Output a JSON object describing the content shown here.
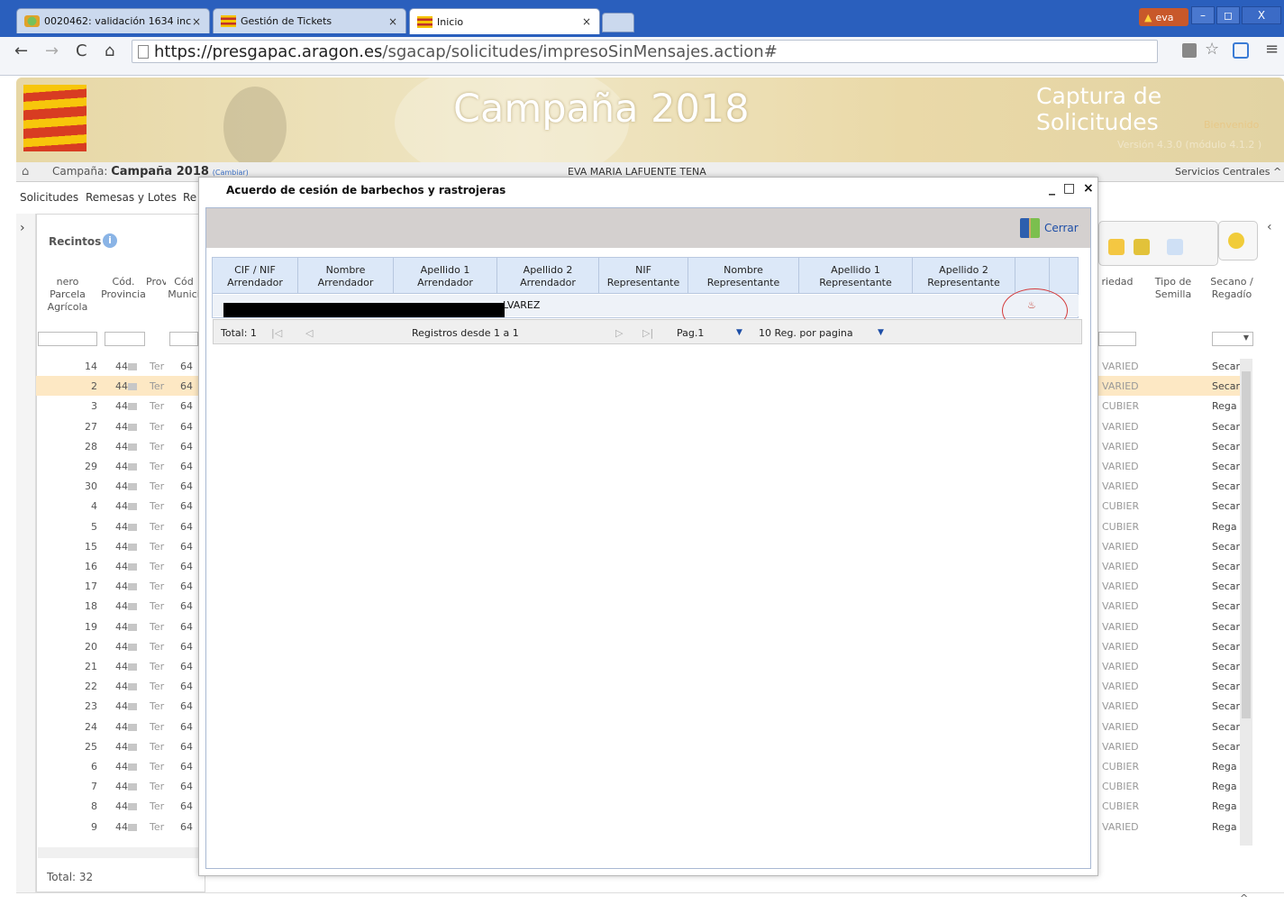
{
  "browser": {
    "tabs": [
      {
        "title": "0020462: validación 1634 inc"
      },
      {
        "title": "Gestión de Tickets"
      },
      {
        "title": "Inicio"
      }
    ],
    "user_badge": "eva",
    "window_controls": [
      "–",
      "◻",
      "X"
    ],
    "url_host": "https://presgapac.aragon.es",
    "url_path": "/sgacap/solicitudes/impresoSinMensajes.action#"
  },
  "app": {
    "campaign_title": "Campaña 2018",
    "capture_title": "Captura de Solicitudes",
    "welcome": "Bienvenido",
    "version": "Versión 4.3.0 (módulo 4.1.2 )",
    "campaign_label": "Campaña:",
    "campaign_value": "Campaña 2018",
    "campaign_change": "(Cambiar)",
    "user_name": "EVA MARIA LAFUENTE TENA",
    "services": "Servicios Centrales ^",
    "menu": [
      "Solicitudes",
      "Remesas y Lotes",
      "Re"
    ]
  },
  "recintos": {
    "title": "Recintos",
    "headers": [
      "nero Parcela Agrícola",
      "Cód. Provincia",
      "Prov",
      "Cód Munici"
    ],
    "rows": [
      {
        "n": "14",
        "prov": "44",
        "name": "Ter",
        "mun": "64"
      },
      {
        "n": "2",
        "prov": "44",
        "name": "Ter",
        "mun": "64"
      },
      {
        "n": "3",
        "prov": "44",
        "name": "Ter",
        "mun": "64"
      },
      {
        "n": "27",
        "prov": "44",
        "name": "Ter",
        "mun": "64"
      },
      {
        "n": "28",
        "prov": "44",
        "name": "Ter",
        "mun": "64"
      },
      {
        "n": "29",
        "prov": "44",
        "name": "Ter",
        "mun": "64"
      },
      {
        "n": "30",
        "prov": "44",
        "name": "Ter",
        "mun": "64"
      },
      {
        "n": "4",
        "prov": "44",
        "name": "Ter",
        "mun": "64"
      },
      {
        "n": "5",
        "prov": "44",
        "name": "Ter",
        "mun": "64"
      },
      {
        "n": "15",
        "prov": "44",
        "name": "Ter",
        "mun": "64"
      },
      {
        "n": "16",
        "prov": "44",
        "name": "Ter",
        "mun": "64"
      },
      {
        "n": "17",
        "prov": "44",
        "name": "Ter",
        "mun": "64"
      },
      {
        "n": "18",
        "prov": "44",
        "name": "Ter",
        "mun": "64"
      },
      {
        "n": "19",
        "prov": "44",
        "name": "Ter",
        "mun": "64"
      },
      {
        "n": "20",
        "prov": "44",
        "name": "Ter",
        "mun": "64"
      },
      {
        "n": "21",
        "prov": "44",
        "name": "Ter",
        "mun": "64"
      },
      {
        "n": "22",
        "prov": "44",
        "name": "Ter",
        "mun": "64"
      },
      {
        "n": "23",
        "prov": "44",
        "name": "Ter",
        "mun": "64"
      },
      {
        "n": "24",
        "prov": "44",
        "name": "Ter",
        "mun": "64"
      },
      {
        "n": "25",
        "prov": "44",
        "name": "Ter",
        "mun": "64"
      },
      {
        "n": "6",
        "prov": "44",
        "name": "Ter",
        "mun": "64"
      },
      {
        "n": "7",
        "prov": "44",
        "name": "Ter",
        "mun": "64"
      },
      {
        "n": "8",
        "prov": "44",
        "name": "Ter",
        "mun": "64"
      },
      {
        "n": "9",
        "prov": "44",
        "name": "Ter",
        "mun": "64"
      }
    ],
    "total": "Total: 32"
  },
  "right_grid": {
    "headers": [
      "riedad",
      "Tipo de Semilla",
      "Secano / Regadío"
    ],
    "rows": [
      {
        "a": "VARIED",
        "b": "Secar"
      },
      {
        "a": "VARIED",
        "b": "Secar"
      },
      {
        "a": "CUBIER",
        "b": "Rega"
      },
      {
        "a": "VARIED",
        "b": "Secar"
      },
      {
        "a": "VARIED",
        "b": "Secar"
      },
      {
        "a": "VARIED",
        "b": "Secar"
      },
      {
        "a": "VARIED",
        "b": "Secar"
      },
      {
        "a": "CUBIER",
        "b": "Secar"
      },
      {
        "a": "CUBIER",
        "b": "Rega"
      },
      {
        "a": "VARIED",
        "b": "Secar"
      },
      {
        "a": "VARIED",
        "b": "Secar"
      },
      {
        "a": "VARIED",
        "b": "Secar"
      },
      {
        "a": "VARIED",
        "b": "Secar"
      },
      {
        "a": "VARIED",
        "b": "Secar"
      },
      {
        "a": "VARIED",
        "b": "Secar"
      },
      {
        "a": "VARIED",
        "b": "Secar"
      },
      {
        "a": "VARIED",
        "b": "Secar"
      },
      {
        "a": "VARIED",
        "b": "Secar"
      },
      {
        "a": "VARIED",
        "b": "Secar"
      },
      {
        "a": "VARIED",
        "b": "Secar"
      },
      {
        "a": "CUBIER",
        "b": "Rega"
      },
      {
        "a": "CUBIER",
        "b": "Rega"
      },
      {
        "a": "CUBIER",
        "b": "Rega"
      },
      {
        "a": "VARIED",
        "b": "Rega"
      }
    ]
  },
  "modal": {
    "title": "Acuerdo de cesión de barbechos y rastrojeras",
    "controls": "_ □ ×",
    "close_label": "Cerrar",
    "headers": [
      "CIF / NIF Arrendador",
      "Nombre Arrendador",
      "Apellido 1 Arrendador",
      "Apellido 2 Arrendador",
      "NIF Representante",
      "Nombre Representante",
      "Apellido 1 Representante",
      "Apellido 2 Representante"
    ],
    "row_visible_text": "LVAREZ",
    "pager": {
      "total": "Total: 1",
      "range": "Registros desde 1 a 1",
      "page": "Pag.1",
      "per_page": "10 Reg. por pagina"
    }
  }
}
